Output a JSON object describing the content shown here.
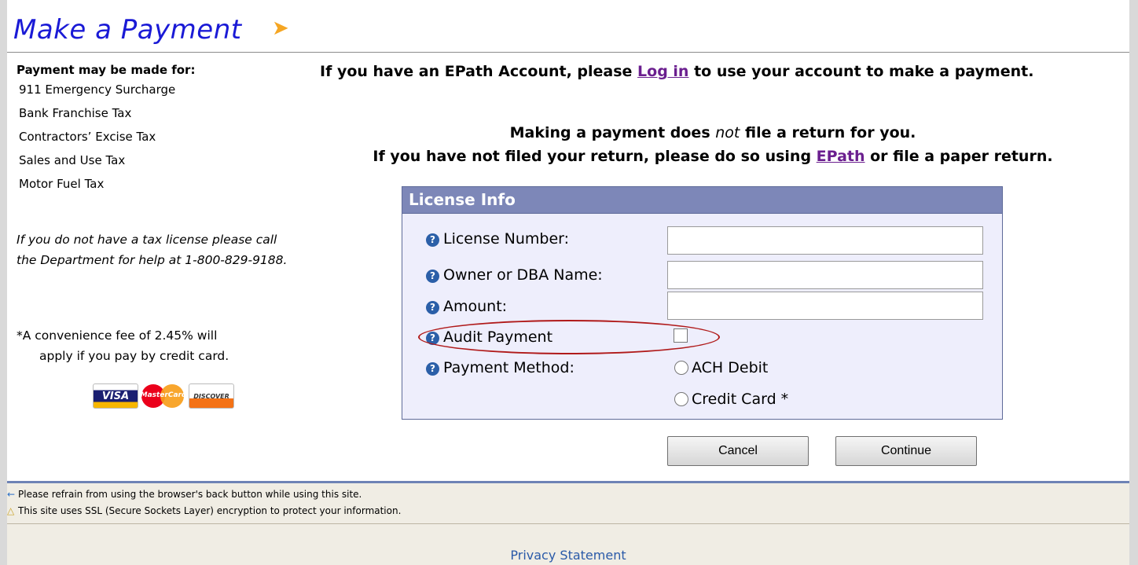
{
  "header": {
    "title": "Make a Payment",
    "arrow": "➤"
  },
  "left": {
    "heading": "Payment may be made for:",
    "tax_types": [
      "911 Emergency Surcharge",
      "Bank Franchise Tax",
      "Contractors’ Excise Tax",
      "Sales and Use Tax",
      "Motor Fuel Tax"
    ],
    "license_note": "If you do not have a tax license please call the Department for help at 1-800-829-9188.",
    "fee_line1": "*A convenience fee of 2.45% will",
    "fee_line2": "apply if you pay by credit card.",
    "cards": {
      "visa": "VISA",
      "mastercard": "MasterCard",
      "discover": "DISCOVER"
    }
  },
  "main": {
    "epath_pre": "If you have an EPath Account, please ",
    "login_link": "Log in",
    "epath_post": " to use your account to make a payment.",
    "notice1_pre": "Making a payment does ",
    "notice1_em": "not",
    "notice1_post": " file a return for you.",
    "notice2_pre": "If you have not filed your return, please do so using ",
    "epath_link": "EPath",
    "notice2_post": " or file a paper return."
  },
  "form": {
    "panel_title": "License Info",
    "help_icon": "?",
    "license_label": "License Number:",
    "license_value": "",
    "owner_label": "Owner or DBA Name:",
    "owner_value": "",
    "amount_label": "Amount:",
    "amount_value": "",
    "audit_label": "Audit Payment",
    "payment_label": "Payment Method:",
    "ach_label": "ACH Debit",
    "card_label": "Credit Card *",
    "cancel": "Cancel",
    "continue": "Continue"
  },
  "footer": {
    "back_note": "Please refrain from using the browser's back button while using this site.",
    "ssl_note": "This site uses SSL (Secure Sockets Layer) encryption to protect your information.",
    "privacy": "Privacy Statement"
  },
  "colors": {
    "title": "#1a1ad6",
    "panel_header": "#7d87b8",
    "panel_bg": "#eeeefc",
    "link": "#6b1f8f",
    "highlight_oval": "#b01a1a"
  }
}
